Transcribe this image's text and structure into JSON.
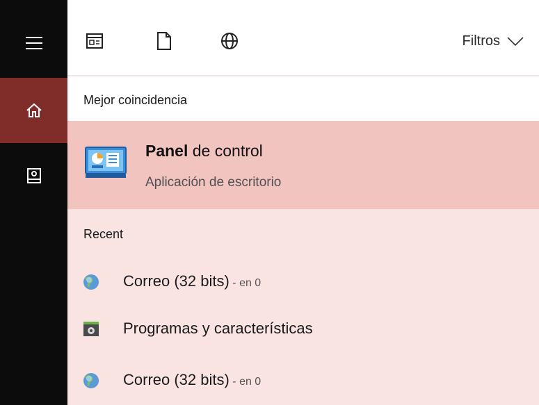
{
  "toolbar": {
    "icons": [
      "apps-icon",
      "document-icon",
      "web-icon"
    ],
    "filters_label": "Filtros"
  },
  "best_match": {
    "section_title": "Mejor coincidencia",
    "item": {
      "title_bold": "Panel",
      "title_rest": " de control",
      "subtitle": "Aplicación de escritorio",
      "icon": "control-panel-icon"
    }
  },
  "recent": {
    "section_title": "Recent",
    "items": [
      {
        "label": "Correo (32 bits)",
        "suffix": " - en 0",
        "icon": "mail-globe-icon"
      },
      {
        "label": "Programas y características",
        "suffix": "",
        "icon": "programs-features-icon"
      },
      {
        "label": "Correo (32 bits)",
        "suffix": " - en 0",
        "icon": "mail-globe-icon"
      }
    ]
  },
  "colors": {
    "rail_bg": "#0c0c0c",
    "rail_selected": "#802d2a",
    "best_item_bg": "#f2c4c0",
    "recent_bg": "#f9e4e2"
  }
}
